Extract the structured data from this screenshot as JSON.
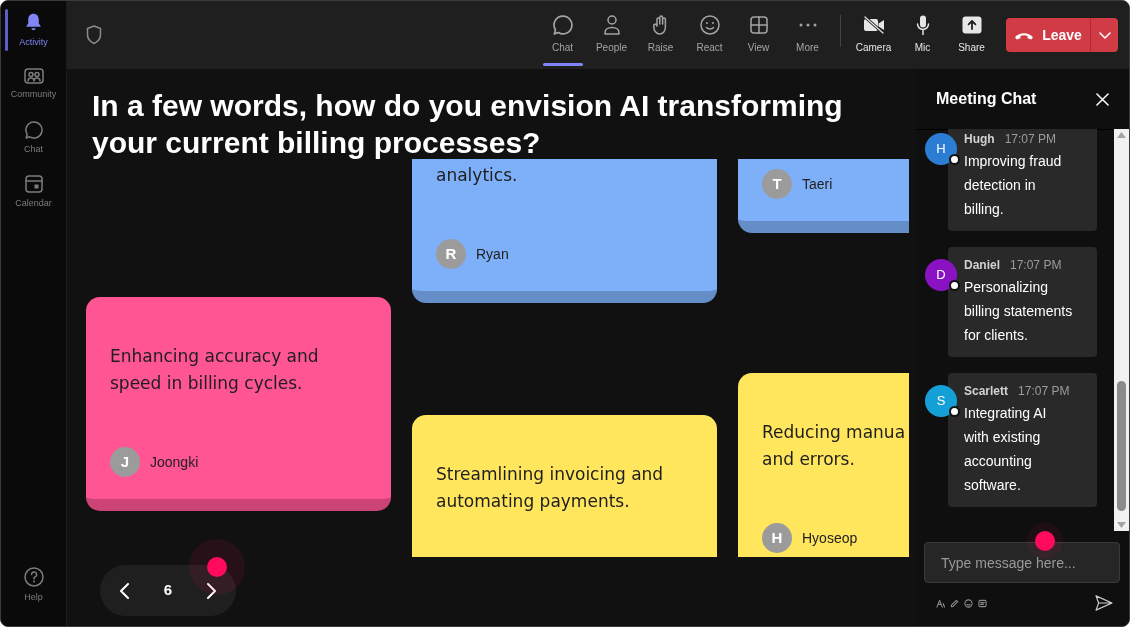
{
  "sidebar": {
    "items": [
      {
        "label": "Activity",
        "selected": true
      },
      {
        "label": "Community",
        "selected": false
      },
      {
        "label": "Chat",
        "selected": false
      },
      {
        "label": "Calendar",
        "selected": false
      }
    ],
    "footer_items": [
      {
        "label": "Help"
      }
    ]
  },
  "toolbar": {
    "tools": [
      {
        "label": "Chat",
        "selected": true
      },
      {
        "label": "People",
        "selected": false
      },
      {
        "label": "Raise",
        "selected": false
      },
      {
        "label": "React",
        "selected": false
      },
      {
        "label": "View",
        "selected": false
      },
      {
        "label": "More",
        "selected": false
      }
    ],
    "devices": [
      {
        "label": "Camera"
      },
      {
        "label": "Mic"
      },
      {
        "label": "Share"
      }
    ],
    "leave_button": {
      "label": "Leave"
    }
  },
  "question": {
    "title_lines": [
      "In a few words, how do you envision AI transforming",
      "your current billing processes?"
    ]
  },
  "board": {
    "columns": [
      {
        "cards": [
          {
            "color": "#ff5592",
            "text_lines": [
              "Enhancing accuracy and",
              "speed in billing cycles."
            ],
            "author": {
              "initial": "J",
              "name": "Joongki"
            }
          }
        ]
      },
      {
        "cards": [
          {
            "color": "#7eb0fa",
            "text_lines": [
              "analytics."
            ],
            "author": {
              "initial": "R",
              "name": "Ryan"
            }
          },
          {
            "color": "#ffe65c",
            "text_lines": [
              "Streamlining invoicing and",
              "automating payments."
            ]
          }
        ]
      },
      {
        "cards": [
          {
            "color": "#7eb0fa",
            "author": {
              "initial": "T",
              "name": "Taeri"
            }
          },
          {
            "color": "#ffe65c",
            "text_lines": [
              "Reducing manua",
              "and errors."
            ],
            "author": {
              "initial": "H",
              "name": "Hyoseop"
            }
          }
        ]
      }
    ]
  },
  "pager": {
    "page": "6"
  },
  "chat": {
    "title": "Meeting Chat",
    "messages": [
      {
        "author": "Hugh",
        "initial": "H",
        "color": "#2b7cd3",
        "time": "17:07 PM",
        "text_lines": [
          "Improving fraud",
          "detection in",
          "billing."
        ]
      },
      {
        "author": "Daniel",
        "initial": "D",
        "color": "#8a12c2",
        "time": "17:07 PM",
        "text_lines": [
          "Personalizing",
          "billing statements",
          "for clients."
        ]
      },
      {
        "author": "Scarlett",
        "initial": "S",
        "color": "#14a0d6",
        "time": "17:07 PM",
        "text_lines": [
          "Integrating AI",
          "with existing",
          "accounting",
          "software."
        ]
      }
    ],
    "composer": {
      "placeholder": "Type message here..."
    }
  }
}
